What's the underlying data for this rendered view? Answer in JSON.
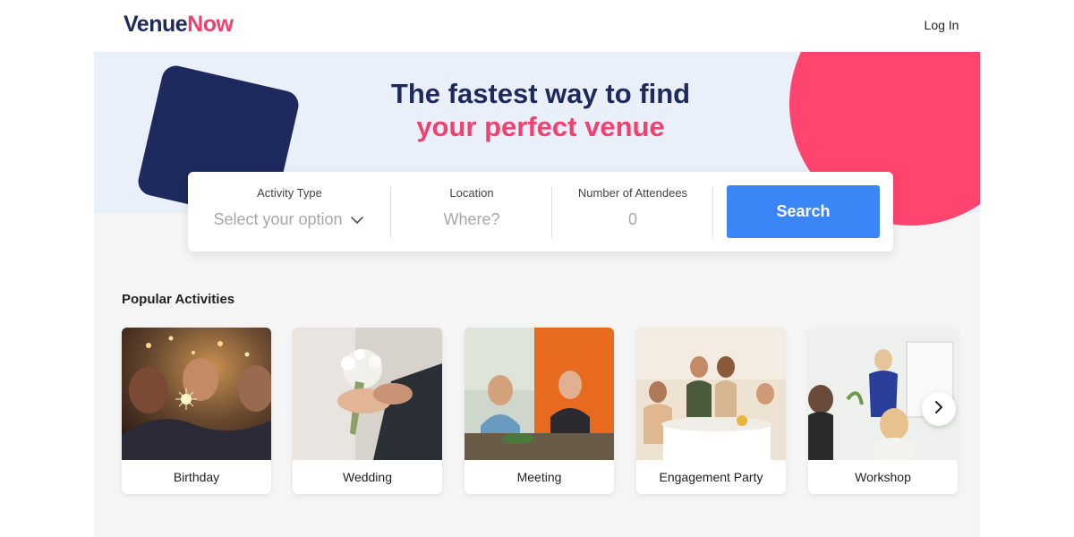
{
  "header": {
    "logo_part1": "Venue",
    "logo_part2": "Now",
    "login_label": "Log In"
  },
  "hero": {
    "headline_line1": "The fastest way to find",
    "headline_line2": "your perfect venue"
  },
  "search": {
    "activity_label": "Activity Type",
    "activity_value": "Select your option",
    "location_label": "Location",
    "location_placeholder": "Where?",
    "attendees_label": "Number of Attendees",
    "attendees_value": "0",
    "button_label": "Search"
  },
  "popular": {
    "title": "Popular Activities",
    "items": [
      {
        "label": "Birthday"
      },
      {
        "label": "Wedding"
      },
      {
        "label": "Meeting"
      },
      {
        "label": "Engagement Party"
      },
      {
        "label": "Workshop"
      }
    ]
  },
  "icons": {
    "dropdown": "chevron-down-icon",
    "carousel_next": "chevron-right-icon"
  },
  "colors": {
    "brand_navy": "#1e2a5e",
    "brand_pink": "#f0426e",
    "accent_blue": "#3b86f6",
    "hero_bg": "#e9f0fa"
  }
}
